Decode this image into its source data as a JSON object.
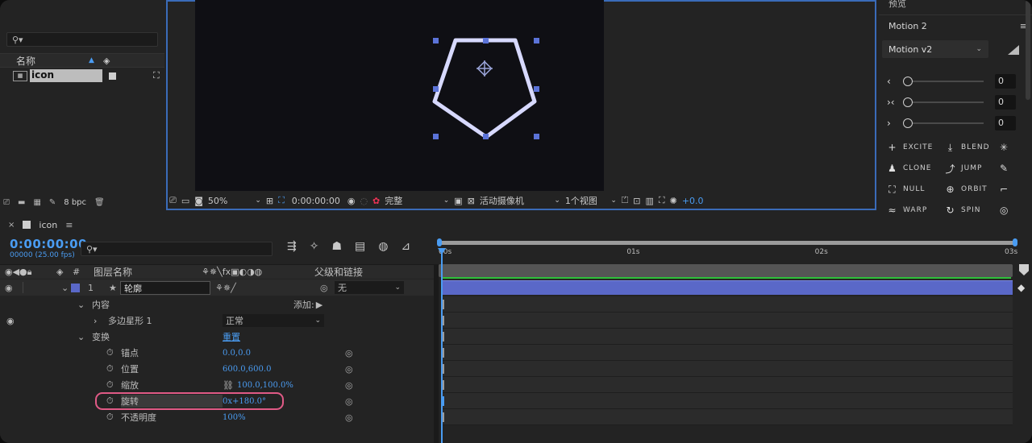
{
  "project": {
    "search_placeholder": "",
    "col_name": "名称",
    "item_name": "icon",
    "bpc": "8 bpc"
  },
  "composition": {
    "zoom": "50%",
    "timecode": "0:00:00:00",
    "quality": "完整",
    "camera": "活动摄像机",
    "views": "1个视图",
    "exposure": "+0.0"
  },
  "motion": {
    "preview_label": "预览",
    "panel_title": "Motion 2",
    "version_select": "Motion v2",
    "sliders": [
      {
        "icon": "chevron-left-icon",
        "glyph": "‹",
        "value": "0"
      },
      {
        "icon": "chevron-both-icon",
        "glyph": "›‹",
        "value": "0"
      },
      {
        "icon": "chevron-right-icon",
        "glyph": "›",
        "value": "0"
      }
    ],
    "buttons_left": [
      "EXCITE",
      "CLONE",
      "NULL",
      "WARP"
    ],
    "buttons_right": [
      "BLEND",
      "JUMP",
      "ORBIT",
      "SPIN"
    ]
  },
  "timeline": {
    "tab_name": "icon",
    "timecode": "0:00:00:00",
    "fps_info": "00000 (25.00 fps)",
    "col_layer_name": "图层名称",
    "col_parent": "父级和链接",
    "ruler": [
      "00s",
      "01s",
      "02s",
      "03s"
    ],
    "layer": {
      "index": "1",
      "name": "轮廓",
      "parent": "无"
    },
    "props": {
      "contents": "内容",
      "add": "添加:",
      "polystar": "多边星形 1",
      "blend_mode": "正常",
      "transform": "变换",
      "reset": "重置",
      "anchor": {
        "label": "锚点",
        "value": "0.0,0.0"
      },
      "position": {
        "label": "位置",
        "value": "600.0,600.0"
      },
      "scale": {
        "label": "缩放",
        "value": "100.0,100.0%"
      },
      "rotation": {
        "label": "旋转",
        "value": "0x+180.0°"
      },
      "opacity": {
        "label": "不透明度",
        "value": "100%"
      }
    }
  },
  "colors": {
    "accent": "#4a9cf2",
    "highlight": "#e05a86",
    "layer_bar": "#5a68c8"
  }
}
